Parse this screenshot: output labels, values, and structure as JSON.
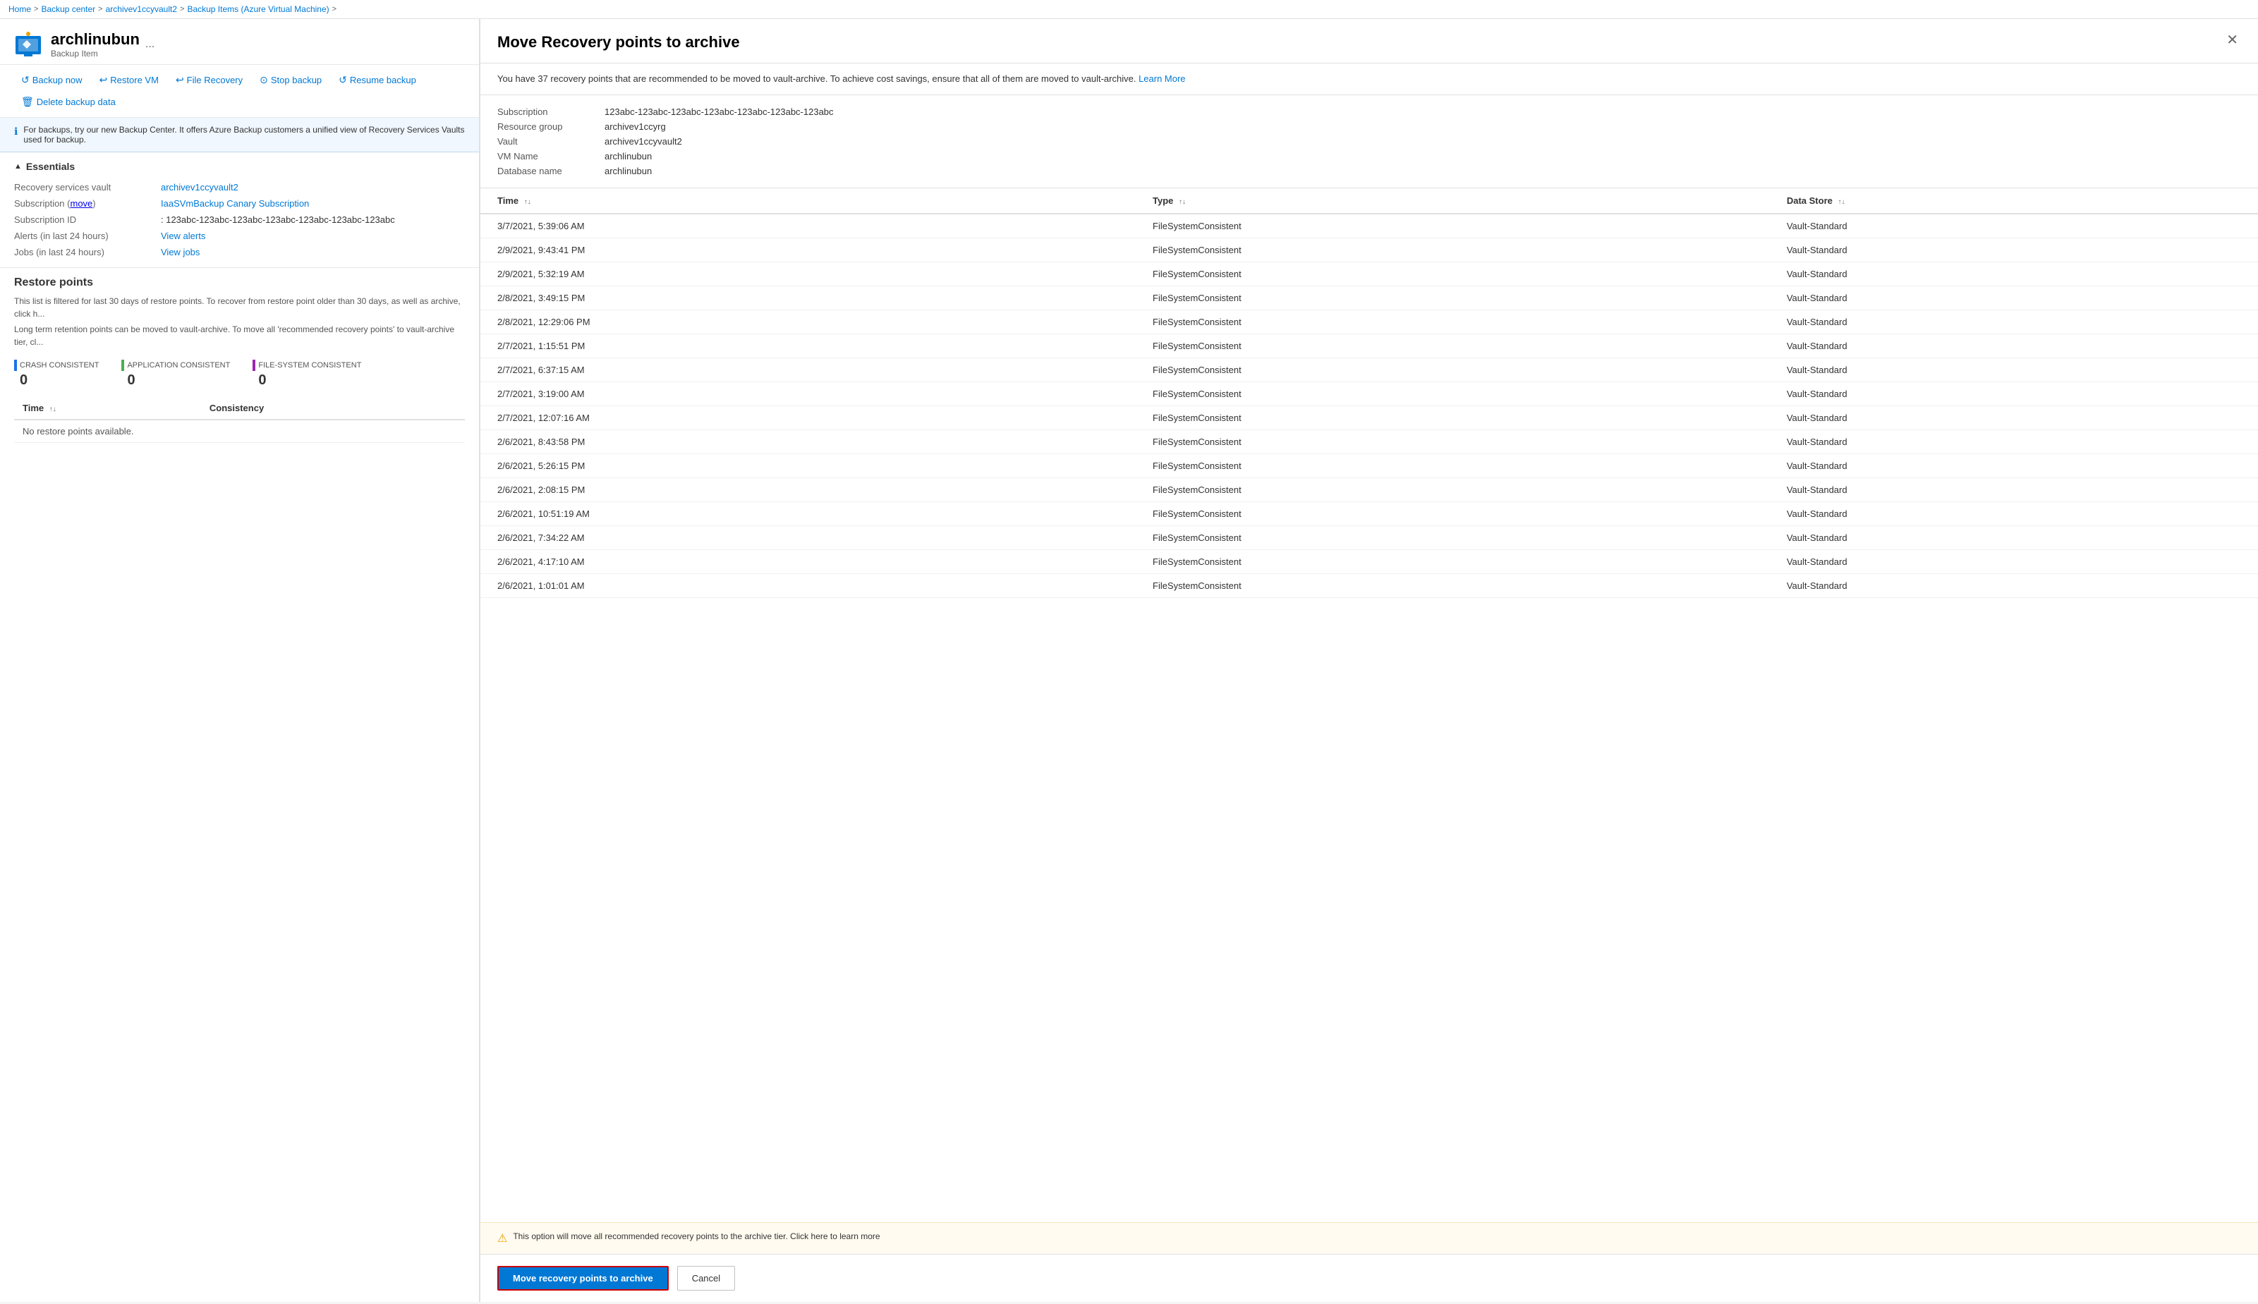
{
  "breadcrumb": {
    "items": [
      {
        "label": "Home",
        "href": "#"
      },
      {
        "label": "Backup center",
        "href": "#"
      },
      {
        "label": "archivev1ccyvault2",
        "href": "#"
      },
      {
        "label": "Backup Items (Azure Virtual Machine)",
        "href": "#"
      }
    ]
  },
  "page": {
    "title": "archlinubun",
    "subtitle": "Backup Item",
    "more_label": "..."
  },
  "toolbar": {
    "buttons": [
      {
        "id": "backup-now",
        "icon": "↺",
        "label": "Backup now"
      },
      {
        "id": "restore-vm",
        "icon": "↩",
        "label": "Restore VM"
      },
      {
        "id": "file-recovery",
        "icon": "↩",
        "label": "File Recovery"
      },
      {
        "id": "stop-backup",
        "icon": "⊙",
        "label": "Stop backup"
      },
      {
        "id": "resume-backup",
        "icon": "↺",
        "label": "Resume backup"
      },
      {
        "id": "delete-backup-data",
        "icon": "🗑",
        "label": "Delete backup data"
      }
    ]
  },
  "banner": {
    "text": "For backups, try our new Backup Center. It offers Azure Backup customers a unified view of Recovery Services Vaults used for backup."
  },
  "essentials": {
    "title": "Essentials",
    "fields": [
      {
        "label": "Recovery services vault",
        "value": "archivev1ccyvault2",
        "link": true
      },
      {
        "label": "Subscription (move)",
        "value": "IaaSVmBackup Canary Subscription",
        "link": true
      },
      {
        "label": "Subscription ID",
        "value": ": 123abc-123abc-123abc-123abc-123abc-123abc-123abc"
      },
      {
        "label": "Alerts (in last 24 hours)",
        "value": "View alerts",
        "link": true
      },
      {
        "label": "Jobs (in last 24 hours)",
        "value": "View jobs",
        "link": true
      }
    ]
  },
  "restore_points": {
    "title": "Restore points",
    "desc1": "This list is filtered for last 30 days of restore points. To recover from restore point older than 30 days, as well as archive, click h...",
    "desc2": "Long term retention points can be moved to vault-archive. To move all 'recommended recovery points' to vault-archive tier, cl...",
    "stats": [
      {
        "label": "CRASH CONSISTENT",
        "value": "0",
        "color": "#1a73e8"
      },
      {
        "label": "APPLICATION CONSISTENT",
        "value": "0",
        "color": "#4caf50"
      },
      {
        "label": "FILE-SYSTEM CONSISTENT",
        "value": "0",
        "color": "#9c27b0"
      }
    ],
    "table_headers": [
      {
        "label": "Time",
        "sortable": true
      },
      {
        "label": "Consistency",
        "sortable": false
      }
    ],
    "no_data": "No restore points available."
  },
  "panel": {
    "title": "Move Recovery points to archive",
    "description": "You have 37 recovery points that are recommended to be moved to vault-archive. To achieve cost savings, ensure that all of them are moved to vault-archive.",
    "learn_more": "Learn More",
    "info": {
      "subscription": "123abc-123abc-123abc-123abc-123abc-123abc-123abc",
      "resource_group": "archivev1ccyrg",
      "vault": "archivev1ccyvault2",
      "vm_name": "archlinubun",
      "database_name": "archlinubun"
    },
    "table": {
      "headers": [
        {
          "label": "Time",
          "sortable": true
        },
        {
          "label": "Type",
          "sortable": true
        },
        {
          "label": "Data Store",
          "sortable": true
        }
      ],
      "rows": [
        {
          "time": "3/7/2021, 5:39:06 AM",
          "type": "FileSystemConsistent",
          "data_store": "Vault-Standard"
        },
        {
          "time": "2/9/2021, 9:43:41 PM",
          "type": "FileSystemConsistent",
          "data_store": "Vault-Standard"
        },
        {
          "time": "2/9/2021, 5:32:19 AM",
          "type": "FileSystemConsistent",
          "data_store": "Vault-Standard"
        },
        {
          "time": "2/8/2021, 3:49:15 PM",
          "type": "FileSystemConsistent",
          "data_store": "Vault-Standard"
        },
        {
          "time": "2/8/2021, 12:29:06 PM",
          "type": "FileSystemConsistent",
          "data_store": "Vault-Standard"
        },
        {
          "time": "2/7/2021, 1:15:51 PM",
          "type": "FileSystemConsistent",
          "data_store": "Vault-Standard"
        },
        {
          "time": "2/7/2021, 6:37:15 AM",
          "type": "FileSystemConsistent",
          "data_store": "Vault-Standard"
        },
        {
          "time": "2/7/2021, 3:19:00 AM",
          "type": "FileSystemConsistent",
          "data_store": "Vault-Standard"
        },
        {
          "time": "2/7/2021, 12:07:16 AM",
          "type": "FileSystemConsistent",
          "data_store": "Vault-Standard"
        },
        {
          "time": "2/6/2021, 8:43:58 PM",
          "type": "FileSystemConsistent",
          "data_store": "Vault-Standard"
        },
        {
          "time": "2/6/2021, 5:26:15 PM",
          "type": "FileSystemConsistent",
          "data_store": "Vault-Standard"
        },
        {
          "time": "2/6/2021, 2:08:15 PM",
          "type": "FileSystemConsistent",
          "data_store": "Vault-Standard"
        },
        {
          "time": "2/6/2021, 10:51:19 AM",
          "type": "FileSystemConsistent",
          "data_store": "Vault-Standard"
        },
        {
          "time": "2/6/2021, 7:34:22 AM",
          "type": "FileSystemConsistent",
          "data_store": "Vault-Standard"
        },
        {
          "time": "2/6/2021, 4:17:10 AM",
          "type": "FileSystemConsistent",
          "data_store": "Vault-Standard"
        },
        {
          "time": "2/6/2021, 1:01:01 AM",
          "type": "FileSystemConsistent",
          "data_store": "Vault-Standard"
        }
      ]
    },
    "warning": "This option will move all recommended recovery points to the archive tier. Click here to learn more",
    "buttons": {
      "primary": "Move recovery points to archive",
      "secondary": "Cancel"
    },
    "info_labels": {
      "subscription": "Subscription",
      "resource_group": "Resource group",
      "vault": "Vault",
      "vm_name": "VM Name",
      "database_name": "Database name"
    }
  }
}
